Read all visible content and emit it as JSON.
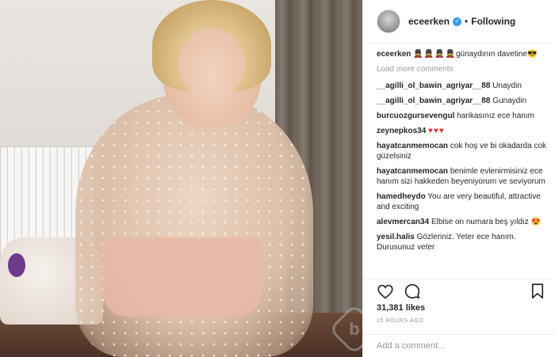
{
  "post": {
    "username": "eceerken",
    "follow_label": "Following",
    "dot": "•",
    "verified_glyph": "✓"
  },
  "caption": {
    "user": "eceerken",
    "emoji": "💂💂💂💂",
    "text": "günaydının davetine😎"
  },
  "load_more_label": "Load more comments",
  "comments": [
    {
      "user": "__agilli_ol_bawin_agriyar__88",
      "text": "Unaydin"
    },
    {
      "user": "__agilli_ol_bawin_agriyar__88",
      "text": "Gunaydin"
    },
    {
      "user": "burcuozgursevengul",
      "text": "harikasınız ece hanım"
    },
    {
      "user": "zeynepkos34",
      "text": "♥♥♥"
    },
    {
      "user": "hayatcanmemocan",
      "text": "cok hoş ve bi okadarda cok güzelsiniz"
    },
    {
      "user": "hayatcanmemocan",
      "text": "benimle evlenirmisiniz ece hanım sizi hakkeden beyeniyorum ve seviyorum"
    },
    {
      "user": "hamedheydo",
      "text": "You are very beautiful, attractive and exciting"
    },
    {
      "user": "alevmercan34",
      "text": "Elbise on numara beş yıldız 😍"
    },
    {
      "user": "yesil.halis",
      "text": "Gözleriniz. Yeter ece hanım. Durusunuz veter"
    }
  ],
  "likes": "31,381 likes",
  "time": "15 HOURS AGO",
  "add_comment_placeholder": "Add a comment...",
  "watermark": "b",
  "icons": {
    "heart": "heart-icon",
    "comment": "comment-icon",
    "bookmark": "bookmark-icon",
    "verified": "verified-badge-icon"
  },
  "colors": {
    "verified": "#3897f0",
    "secondary_text": "#999999",
    "border": "#efefef",
    "emoji_red": "#dd3333"
  }
}
